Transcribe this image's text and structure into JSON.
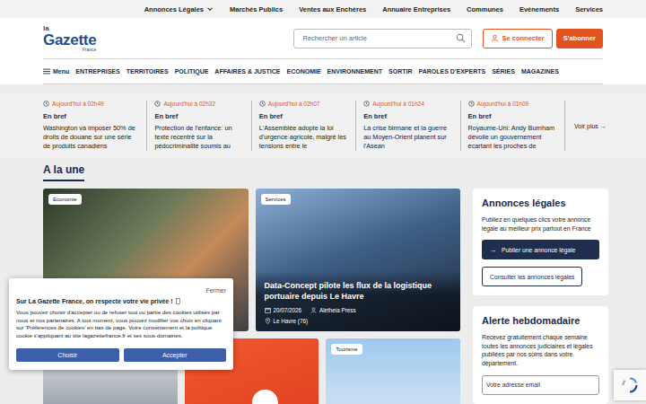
{
  "top_links": [
    {
      "label": "Annonces Légales",
      "has_menu": true
    },
    {
      "label": "Marchés Publics",
      "has_menu": false
    },
    {
      "label": "Ventes aux Enchères",
      "has_menu": false
    },
    {
      "label": "Annuaire Entreprises",
      "has_menu": false
    },
    {
      "label": "Communes",
      "has_menu": false
    },
    {
      "label": "Evénements",
      "has_menu": false
    },
    {
      "label": "Services",
      "has_menu": false
    }
  ],
  "logo": {
    "small": "la",
    "main": "Gazette",
    "sub": "France"
  },
  "search": {
    "placeholder": "Rechercher un article"
  },
  "account": {
    "login": "Se connecter",
    "subscribe": "S'abonner"
  },
  "nav": {
    "menu": "Menu",
    "items": [
      "ENTREPRISES",
      "TERRITOIRES",
      "POLITIQUE",
      "AFFAIRES & JUSTICE",
      "ECONOMIE",
      "ENVIRONNEMENT",
      "SORTIR",
      "PAROLES D'EXPERTS",
      "SÉRIES",
      "MAGAZINES"
    ]
  },
  "briefs": {
    "items": [
      {
        "time": "Aujourd'hui à 02h49",
        "label": "En bref",
        "text": "Washington va imposer 50% de droits de douane sur une série de produits canadiens"
      },
      {
        "time": "Aujourd'hui à 02h32",
        "label": "En bref",
        "text": "Protection de l'enfance: un texte recentré sur la pédocriminalité soumis au"
      },
      {
        "time": "Aujourd'hui à 02h07",
        "label": "En bref",
        "text": "L'Assemblée adopte la loi d'urgence agricole, malgré les tensions entre le"
      },
      {
        "time": "Aujourd'hui à 01h24",
        "label": "En bref",
        "text": "La crise birmane et la guerre au Moyen-Orient planent sur l'Asean"
      },
      {
        "time": "Aujourd'hui à 01h09",
        "label": "En bref",
        "text": "Royaume-Uni: Andy Burnham dévoile un gouvernement écartant les proches de"
      }
    ],
    "more": "Voir plus",
    "more_icon": "→"
  },
  "headline": {
    "title": "A la une",
    "cards": [
      {
        "kind": "photo",
        "tag": "Economie"
      },
      {
        "kind": "feature",
        "tag": "Services",
        "title": "Data-Concept pilote les flux de la logistique portuaire depuis Le Havre",
        "date": "20/07/2026",
        "author": "Aletheia Press",
        "place": "Le Havre (76)"
      },
      {
        "kind": "photo"
      },
      {
        "kind": "photo"
      },
      {
        "kind": "photo",
        "tag": "Tourisme"
      }
    ]
  },
  "legal": {
    "title": "Annonces légales",
    "text": "Publiez en quelques clics votre annonce légale au meilleur prix partout en France",
    "primary_icon": "→",
    "primary": "Publier une annonce légale",
    "secondary": "Consulter les annonces légales"
  },
  "alert": {
    "title": "Alerte hebdomadaire",
    "text": "Recevez gratuitement chaque semaine toutes les annonces judiciaires et légales publiées par nos soins dans votre département.",
    "placeholder": "Votre adresse email"
  },
  "cookie": {
    "close": "Fermer",
    "title": "Sur La Gazette France, on respecte votre vie privée !",
    "text": "Vous pouvez choisir d'accepter ou de refuser tout ou partie des cookies utilisés par nous et nos partenaires. A tout moment, vous pouvez modifier vos choix en cliquant sur 'Préférences de cookies' en bas de page. Votre consentement et la politique cookie s'appliquant au site lagazettefrance.fr et ses sous-domaines.",
    "buttons": [
      "Choisir",
      "Accepter"
    ]
  }
}
